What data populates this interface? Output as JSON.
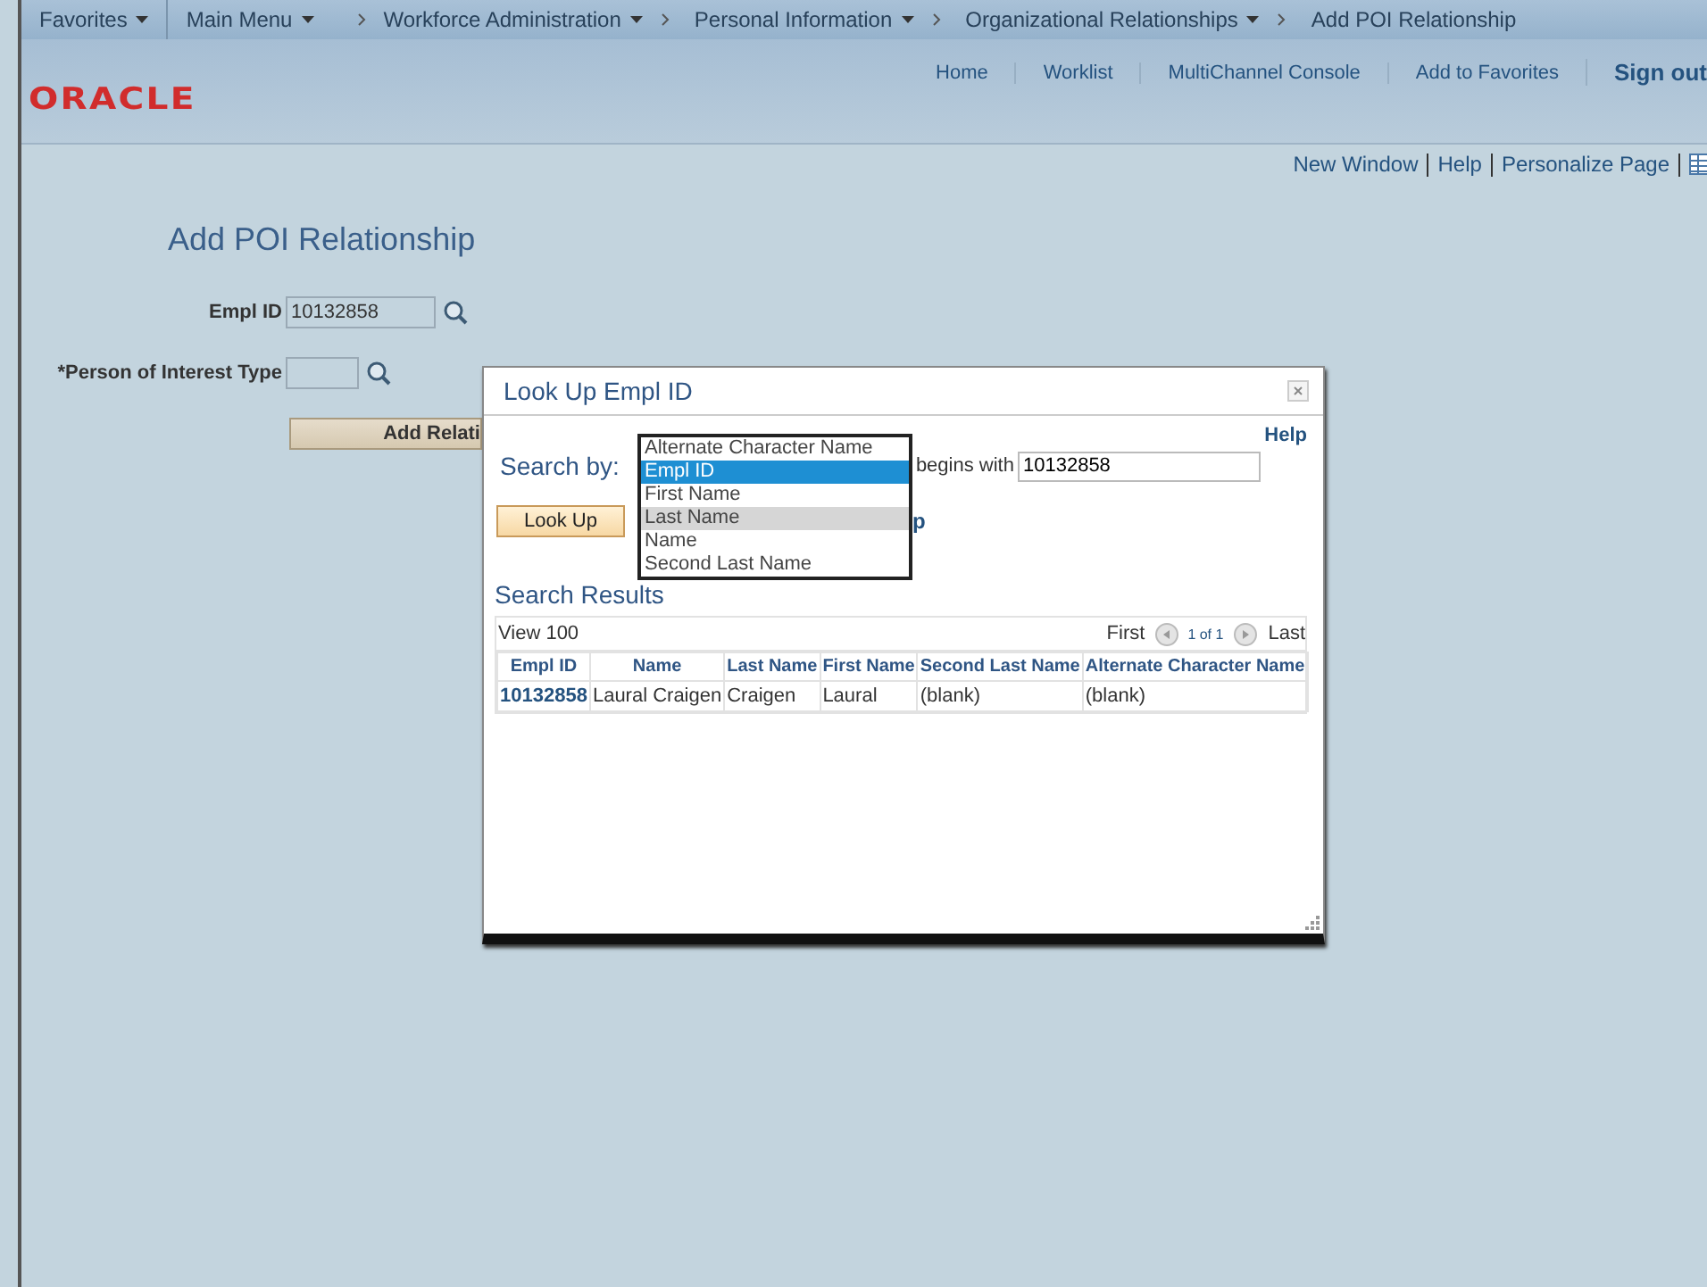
{
  "breadcrumbs": [
    {
      "label": "Favorites",
      "has_menu": true
    },
    {
      "label": "Main Menu",
      "has_menu": true
    },
    {
      "label": "Workforce Administration",
      "has_menu": true
    },
    {
      "label": "Personal Information",
      "has_menu": true
    },
    {
      "label": "Organizational Relationships",
      "has_menu": true
    },
    {
      "label": "Add POI Relationship",
      "has_menu": false
    }
  ],
  "logo": "ORACLE",
  "header_links": [
    {
      "label": "Home",
      "emphasis": false
    },
    {
      "label": "Worklist",
      "emphasis": false
    },
    {
      "label": "MultiChannel Console",
      "emphasis": false
    },
    {
      "label": "Add to Favorites",
      "emphasis": false
    },
    {
      "label": "Sign out",
      "emphasis": true
    }
  ],
  "page_links": [
    "New Window",
    "Help",
    "Personalize Page"
  ],
  "page_title": "Add POI Relationship",
  "fields": [
    {
      "label": "Empl ID",
      "value": "10132858"
    },
    {
      "label": "*Person of Interest Type"
    }
  ],
  "add_button": "Add Relati",
  "modal": {
    "title": "Look Up Empl ID",
    "help": "Help",
    "search_by_label": "Search by:",
    "operator": "begins with",
    "search_value": "10132858",
    "lookup_button": "Look Up",
    "partial_link": "p",
    "search_by_options": [
      {
        "label": "Alternate Character Name",
        "selected": false,
        "hovered": false
      },
      {
        "label": "Empl ID",
        "selected": true,
        "hovered": false
      },
      {
        "label": "First Name",
        "selected": false,
        "hovered": false
      },
      {
        "label": "Last Name",
        "selected": false,
        "hovered": true
      },
      {
        "label": "Name",
        "selected": false,
        "hovered": false
      },
      {
        "label": "Second Last Name",
        "selected": false,
        "hovered": false
      }
    ],
    "results_title": "Search Results",
    "view_all": "View 100",
    "first": "First",
    "page_count": "1 of 1",
    "last": "Last",
    "columns": [
      "Empl ID",
      "Name",
      "Last Name",
      "First Name",
      "Second Last Name",
      "Alternate Character Name"
    ],
    "rows": [
      [
        "10132858",
        "Laural Craigen",
        "Craigen",
        "Laural",
        "(blank)",
        "(blank)"
      ]
    ]
  }
}
